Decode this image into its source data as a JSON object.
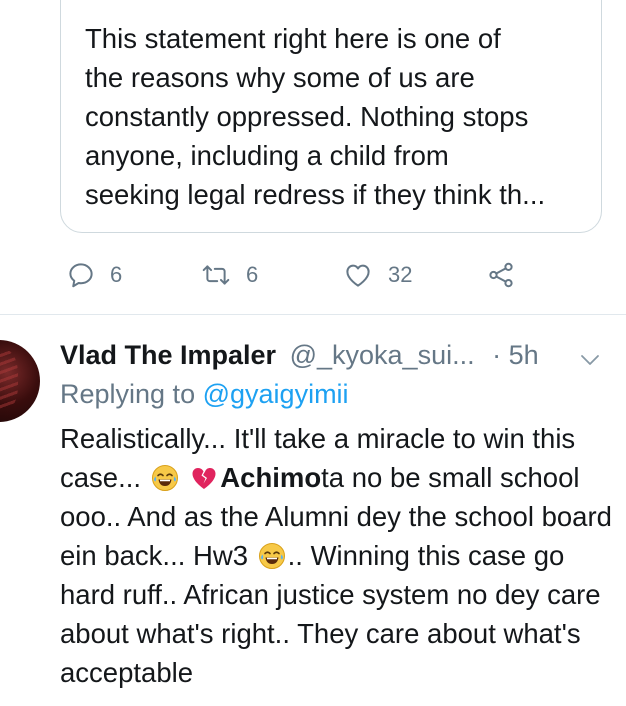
{
  "quoted_tweet": {
    "text": "This statement right here is one of\nthe reasons why some of us are\nconstantly oppressed. Nothing stops\nanyone, including a child from\nseeking legal redress if they think th..."
  },
  "actions": {
    "replies": "6",
    "retweets": "6",
    "likes": "32"
  },
  "reply_tweet": {
    "display_name": "Vlad The Impaler",
    "handle": "@_kyoka_sui...",
    "time": "· 5h",
    "replying_prefix": "Replying to",
    "replying_mention": "@gyaigyimii",
    "text_1": "Realistically... It'll take a miracle to win this case...",
    "text_bold": "Achimo",
    "text_2": "ta no be small school ooo.. And as the Alumni dey the school board ein back... Hw3",
    "text_3": ".. Winning this case go hard ruff.. African justice system no dey care about what's right.. They care about what's acceptable"
  },
  "icons": {
    "reply": "speech-bubble-icon",
    "retweet": "retweet-icon",
    "like": "heart-icon",
    "share": "share-icon",
    "more": "chevron-down-icon",
    "emoji_1": "tears-of-joy-emoji",
    "emoji_2": "broken-heart-emoji",
    "emoji_3": "tears-of-joy-emoji"
  },
  "colors": {
    "muted": "#657786",
    "link": "#1da1f2",
    "text": "#14171a",
    "border": "#cfd9de"
  }
}
